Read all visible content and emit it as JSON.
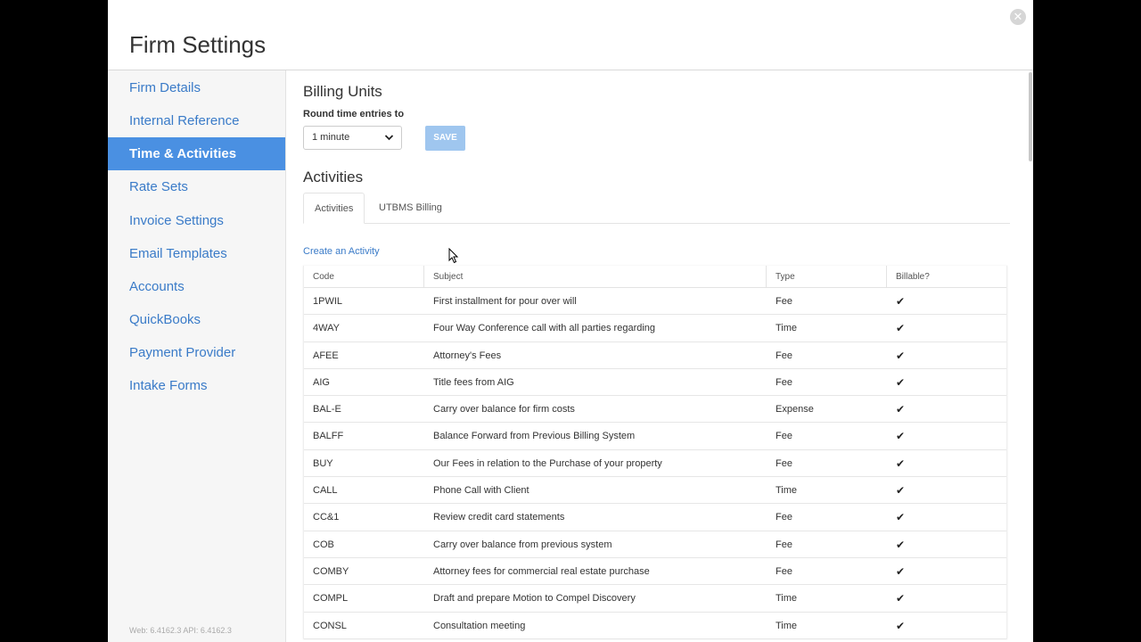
{
  "window": {
    "title": "Firm Settings",
    "version": "Web: 6.4162.3 API: 6.4162.3"
  },
  "colors": {
    "accent": "#4a90e2",
    "link": "#3a7bc8",
    "save_disabled": "#9fc6ef"
  },
  "sidebar": {
    "items": [
      {
        "label": "Firm Details",
        "active": false
      },
      {
        "label": "Internal Reference",
        "active": false
      },
      {
        "label": "Time & Activities",
        "active": true
      },
      {
        "label": "Rate Sets",
        "active": false
      },
      {
        "label": "Invoice Settings",
        "active": false
      },
      {
        "label": "Email Templates",
        "active": false
      },
      {
        "label": "Accounts",
        "active": false
      },
      {
        "label": "QuickBooks",
        "active": false
      },
      {
        "label": "Payment Provider",
        "active": false
      },
      {
        "label": "Intake Forms",
        "active": false
      }
    ]
  },
  "billing": {
    "heading": "Billing Units",
    "round_label": "Round time entries to",
    "round_value": "1 minute",
    "save_label": "SAVE"
  },
  "activities": {
    "heading": "Activities",
    "tabs": [
      {
        "label": "Activities",
        "active": true
      },
      {
        "label": "UTBMS Billing",
        "active": false
      }
    ],
    "create_link": "Create an Activity",
    "columns": {
      "code": "Code",
      "subject": "Subject",
      "type": "Type",
      "billable": "Billable?"
    },
    "rows": [
      {
        "code": "1PWIL",
        "subject": "First installment for pour over will",
        "type": "Fee",
        "billable": true
      },
      {
        "code": "4WAY",
        "subject": "Four Way Conference call with all parties regarding",
        "type": "Time",
        "billable": true
      },
      {
        "code": "AFEE",
        "subject": "Attorney's Fees",
        "type": "Fee",
        "billable": true
      },
      {
        "code": "AIG",
        "subject": "Title fees from AIG",
        "type": "Fee",
        "billable": true
      },
      {
        "code": "BAL-E",
        "subject": "Carry over balance for firm costs",
        "type": "Expense",
        "billable": true
      },
      {
        "code": "BALFF",
        "subject": "Balance Forward from Previous Billing System",
        "type": "Fee",
        "billable": true
      },
      {
        "code": "BUY",
        "subject": "Our Fees in relation to the Purchase of your property",
        "type": "Fee",
        "billable": true
      },
      {
        "code": "CALL",
        "subject": "Phone Call with Client",
        "type": "Time",
        "billable": true
      },
      {
        "code": "CC&1",
        "subject": "Review credit card statements",
        "type": "Fee",
        "billable": true
      },
      {
        "code": "COB",
        "subject": "Carry over balance from previous system",
        "type": "Fee",
        "billable": true
      },
      {
        "code": "COMBY",
        "subject": "Attorney fees for commercial real estate purchase",
        "type": "Fee",
        "billable": true
      },
      {
        "code": "COMPL",
        "subject": "Draft and prepare Motion to Compel Discovery",
        "type": "Time",
        "billable": true
      },
      {
        "code": "CONSL",
        "subject": "Consultation meeting",
        "type": "Time",
        "billable": true
      }
    ]
  },
  "icons": {
    "close": "close-icon",
    "chevron": "chevron-down-icon",
    "check": "check-icon",
    "cursor": "mouse-pointer-icon"
  }
}
